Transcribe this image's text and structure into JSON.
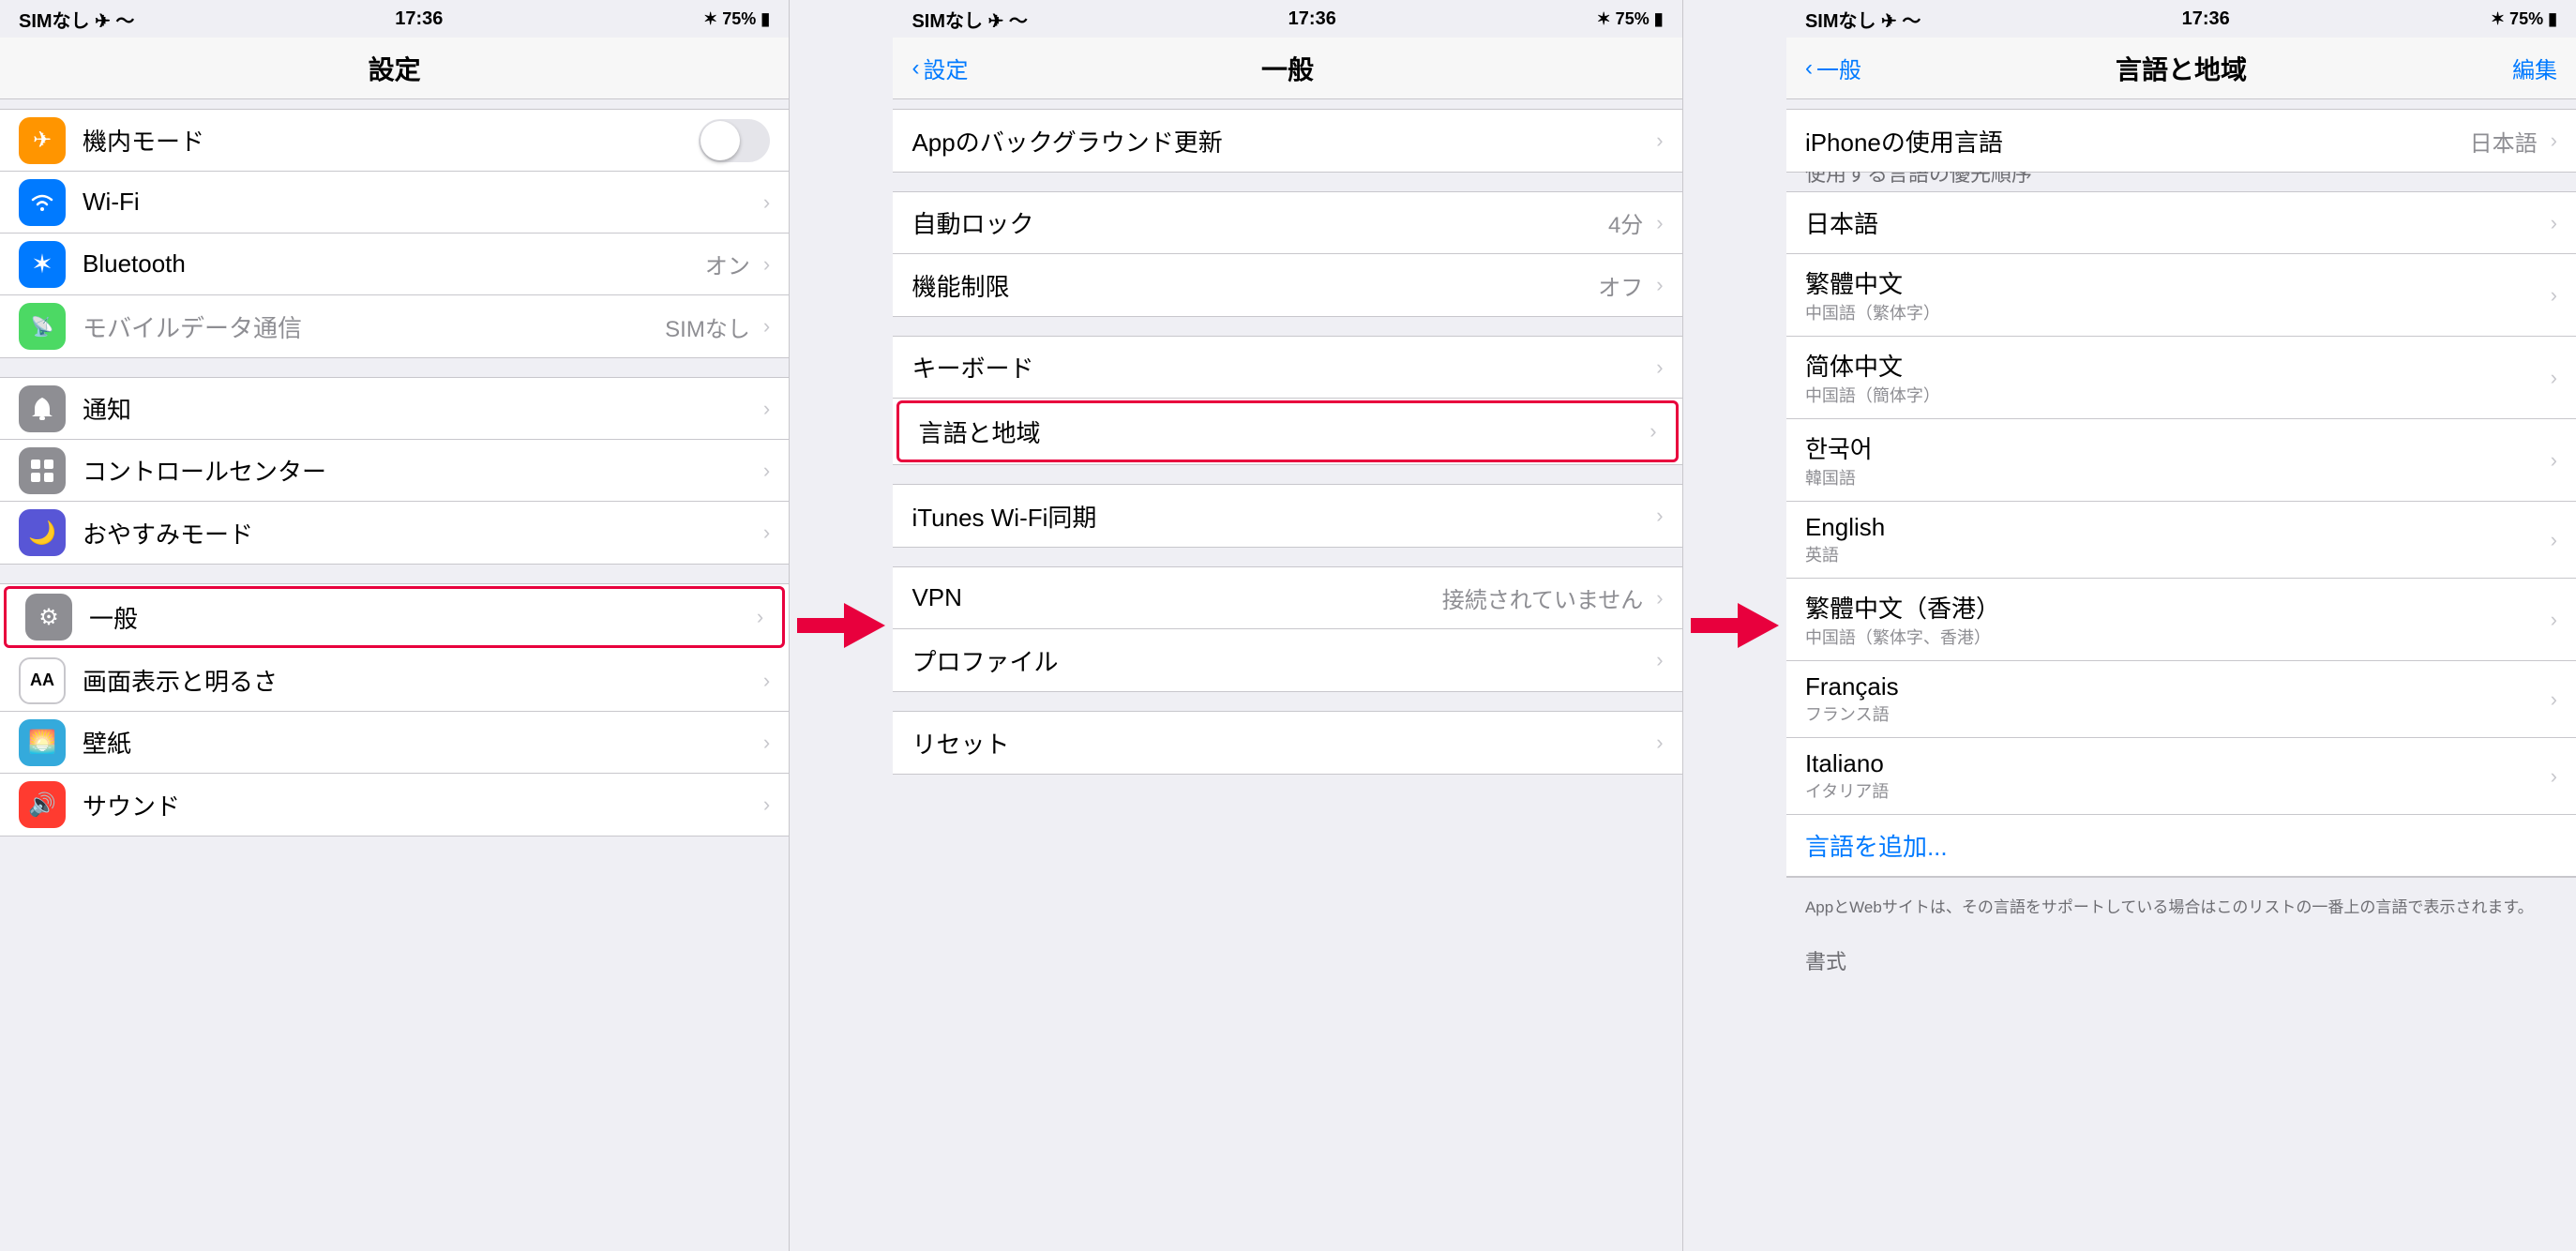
{
  "panels": [
    {
      "id": "settings",
      "status": {
        "left": "SIMなし ✈ 〜",
        "time": "17:36",
        "right": "✶ 75% ▮"
      },
      "nav": {
        "title": "設定",
        "back": null,
        "action": null
      },
      "sections": [
        {
          "id": "connectivity",
          "cells": [
            {
              "id": "airplane",
              "icon": "✈",
              "iconClass": "icon-orange",
              "label": "機内モード",
              "value": null,
              "toggle": true,
              "chevron": false
            },
            {
              "id": "wifi",
              "icon": "📶",
              "iconClass": "icon-blue",
              "label": "Wi-Fi",
              "value": null,
              "toggle": false,
              "chevron": true
            },
            {
              "id": "bluetooth",
              "icon": "✶",
              "iconClass": "icon-bluetooth",
              "label": "Bluetooth",
              "value": "オン",
              "toggle": false,
              "chevron": true
            },
            {
              "id": "mobile",
              "icon": "📡",
              "iconClass": "icon-green",
              "label": "モバイルデータ通信",
              "value": "SIMなし",
              "toggle": false,
              "chevron": true
            }
          ]
        },
        {
          "id": "notifications",
          "cells": [
            {
              "id": "notification",
              "icon": "🔔",
              "iconClass": "icon-gray",
              "label": "通知",
              "value": null,
              "toggle": false,
              "chevron": true
            },
            {
              "id": "control",
              "icon": "⊞",
              "iconClass": "icon-gray",
              "label": "コントロールセンター",
              "value": null,
              "toggle": false,
              "chevron": true
            },
            {
              "id": "donotdisturb",
              "icon": "🌙",
              "iconClass": "icon-purple",
              "label": "おやすみモード",
              "value": null,
              "toggle": false,
              "chevron": true
            }
          ]
        },
        {
          "id": "system",
          "cells": [
            {
              "id": "general",
              "icon": "⚙",
              "iconClass": "icon-general",
              "label": "一般",
              "value": null,
              "toggle": false,
              "chevron": true,
              "highlighted": true
            },
            {
              "id": "display",
              "icon": "AA",
              "iconClass": "icon-display",
              "label": "画面表示と明るさ",
              "value": null,
              "toggle": false,
              "chevron": true
            },
            {
              "id": "wallpaper",
              "icon": "🌅",
              "iconClass": "icon-wallpaper",
              "label": "壁紙",
              "value": null,
              "toggle": false,
              "chevron": true
            },
            {
              "id": "sound",
              "icon": "🔊",
              "iconClass": "icon-sound",
              "label": "サウンド",
              "value": null,
              "toggle": false,
              "chevron": true
            }
          ]
        }
      ]
    },
    {
      "id": "general",
      "status": {
        "left": "SIMなし ✈ 〜",
        "time": "17:36",
        "right": "✶ 75% ▮"
      },
      "nav": {
        "title": "一般",
        "back": "設定",
        "action": null
      },
      "sections": [
        {
          "id": "top",
          "cells": [
            {
              "id": "bg-refresh",
              "label": "Appのバックグラウンド更新",
              "value": null,
              "chevron": true
            }
          ]
        },
        {
          "id": "lock",
          "cells": [
            {
              "id": "autolock",
              "label": "自動ロック",
              "value": "4分",
              "chevron": true
            },
            {
              "id": "restrictions",
              "label": "機能制限",
              "value": "オフ",
              "chevron": true
            }
          ]
        },
        {
          "id": "keyboard-lang",
          "cells": [
            {
              "id": "keyboard",
              "label": "キーボード",
              "value": null,
              "chevron": true
            },
            {
              "id": "lang-region",
              "label": "言語と地域",
              "value": null,
              "chevron": true,
              "highlighted": true
            }
          ]
        },
        {
          "id": "itunes",
          "cells": [
            {
              "id": "itunes-wifi",
              "label": "iTunes Wi-Fi同期",
              "value": null,
              "chevron": true
            }
          ]
        },
        {
          "id": "vpn-profile",
          "cells": [
            {
              "id": "vpn",
              "label": "VPN",
              "value": "接続されていません",
              "chevron": true
            },
            {
              "id": "profile",
              "label": "プロファイル",
              "value": null,
              "chevron": true
            }
          ]
        },
        {
          "id": "reset",
          "cells": [
            {
              "id": "reset",
              "label": "リセット",
              "value": null,
              "chevron": true
            }
          ]
        }
      ]
    },
    {
      "id": "lang-region",
      "status": {
        "left": "SIMなし ✈ 〜",
        "time": "17:36",
        "right": "✶ 75% ▮"
      },
      "nav": {
        "title": "言語と地域",
        "back": "一般",
        "action": "編集"
      },
      "iphone_language": {
        "label": "iPhoneの使用言語",
        "value": "日本語"
      },
      "priority_header": "使用する言語の優先順序",
      "languages": [
        {
          "id": "ja",
          "main": "日本語",
          "sub": null
        },
        {
          "id": "zh-hant",
          "main": "繁體中文",
          "sub": "中国語（繁体字）"
        },
        {
          "id": "zh-hans",
          "main": "简体中文",
          "sub": "中国語（簡体字）"
        },
        {
          "id": "ko",
          "main": "한국어",
          "sub": "韓国語"
        },
        {
          "id": "en",
          "main": "English",
          "sub": "英語"
        },
        {
          "id": "zh-hant-hk",
          "main": "繁體中文（香港）",
          "sub": "中国語（繁体字、香港）"
        },
        {
          "id": "fr",
          "main": "Français",
          "sub": "フランス語"
        },
        {
          "id": "it",
          "main": "Italiano",
          "sub": "イタリア語"
        }
      ],
      "add_language": "言語を追加...",
      "footnote": "AppとWebサイトは、その言語をサポートしている場合はこのリストの一番上の言語で表示されます。",
      "format_header": "書式"
    }
  ]
}
